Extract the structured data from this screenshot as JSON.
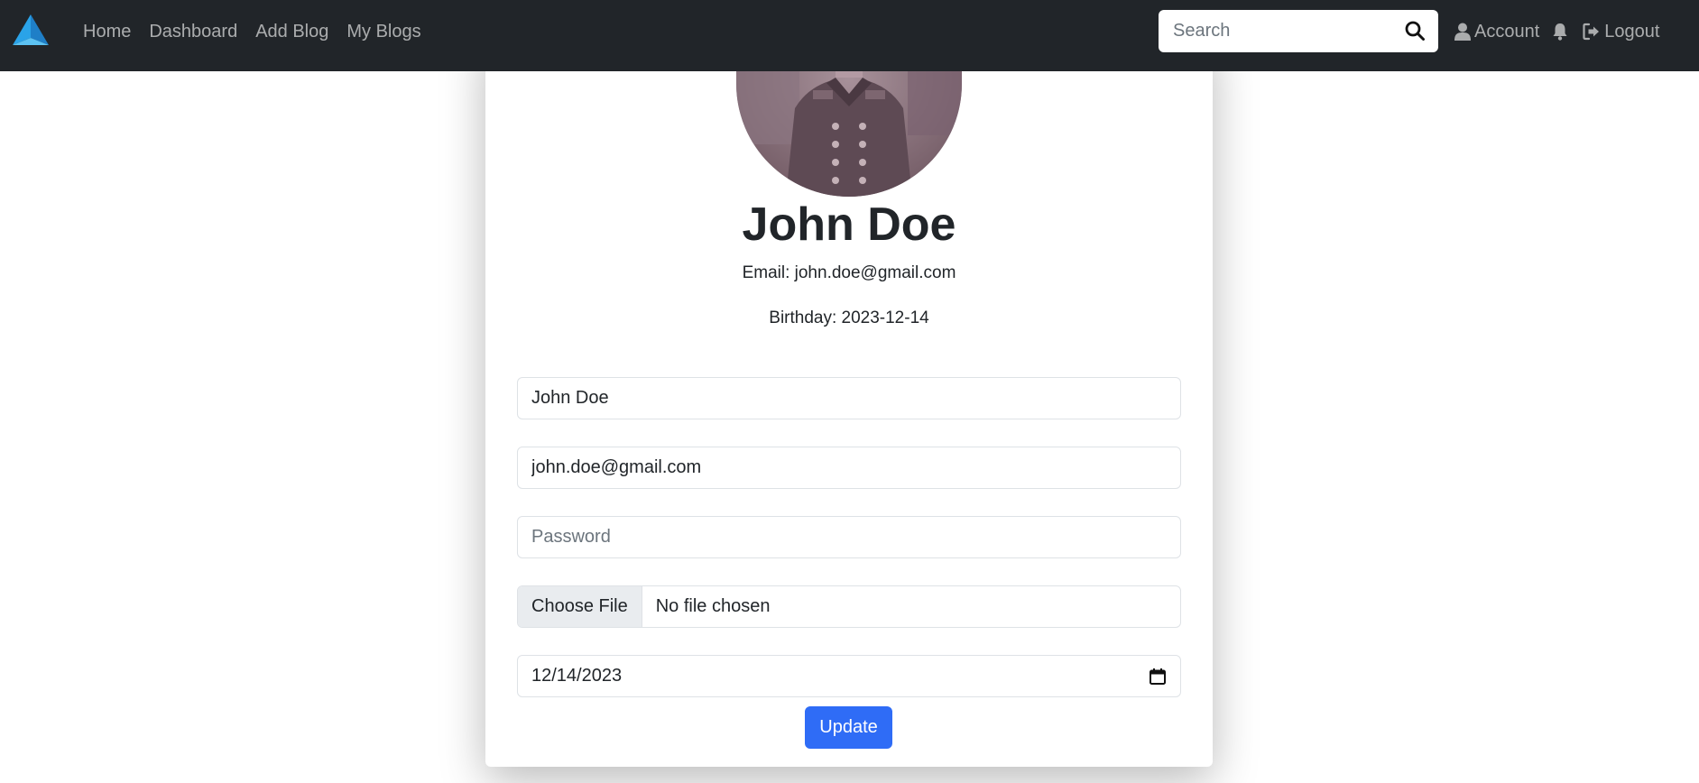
{
  "navbar": {
    "logo_icon": "triangle-logo-icon",
    "links": [
      "Home",
      "Dashboard",
      "Add Blog",
      "My Blogs"
    ],
    "search": {
      "placeholder": "Search",
      "value": ""
    },
    "search_icon": "magnifier-icon",
    "account_label": "Account",
    "account_icon": "user-icon",
    "notifications_icon": "bell-icon",
    "logout_label": "Logout",
    "logout_icon": "sign-out-icon",
    "background_color": "#212529"
  },
  "profile": {
    "name": "John Doe",
    "email_line": "Email: john.doe@gmail.com",
    "birthday_line": "Birthday: 2023-12-14"
  },
  "form": {
    "name_value": "John Doe",
    "email_value": "john.doe@gmail.com",
    "password_placeholder": "Password",
    "password_value": "",
    "file_button_label": "Choose File",
    "file_status": "No file chosen",
    "date_value": "12/14/2023",
    "calendar_icon": "calendar-icon",
    "submit_label": "Update",
    "primary_color": "#2f6cf6"
  }
}
